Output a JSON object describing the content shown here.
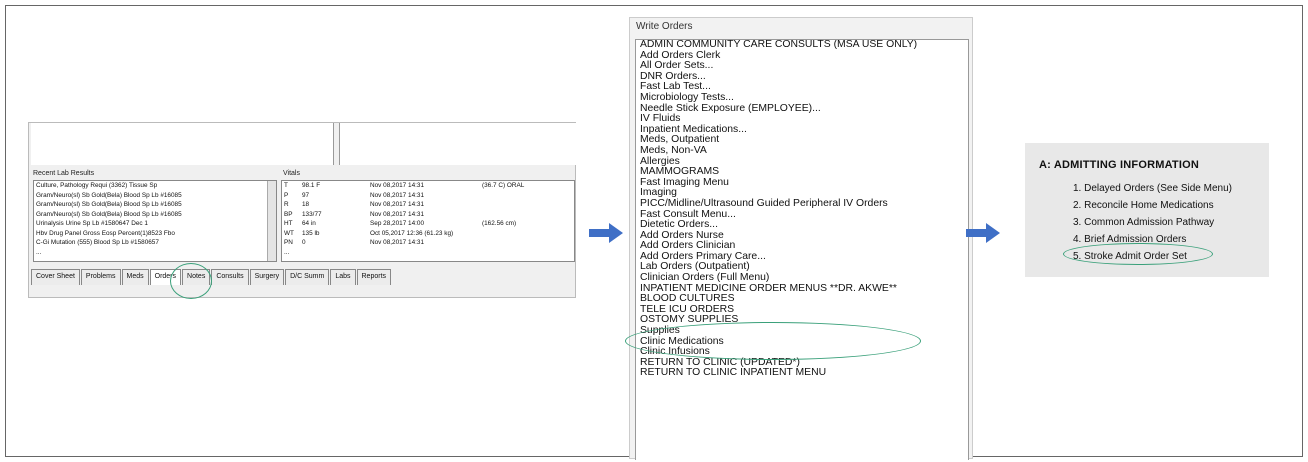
{
  "panel1": {
    "lab_title": "Recent Lab Results",
    "vitals_title": "Vitals",
    "lab_rows": [
      "Culture, Pathology Requi (3362) Tissue Sp",
      "Gram/Neuro(sl) Sb Gold(Bela) Blood Sp Lb #16085",
      "Gram/Neuro(sl) Sb Gold(Bela) Blood Sp Lb #16085",
      "Gram/Neuro(sl) Sb Gold(Bela) Blood Sp Lb #16085",
      "Urinalysis Urine Sp Lb #1580647         Dec 1",
      "Hbv Drug Panel Gross Eosp Percent(1)8523 Fbo",
      "C-Gi Mutation (555) Blood  Sp Lb #1580657",
      "..."
    ],
    "vitals_rows": [
      {
        "k": "T",
        "v": "98.1 F",
        "d": "Nov 08,2017 14:31",
        "x": "(36.7 C)  ORAL"
      },
      {
        "k": "P",
        "v": "97",
        "d": "Nov 08,2017 14:31",
        "x": ""
      },
      {
        "k": "R",
        "v": "18",
        "d": "Nov 08,2017 14:31",
        "x": ""
      },
      {
        "k": "BP",
        "v": "133/77",
        "d": "Nov 08,2017 14:31",
        "x": ""
      },
      {
        "k": "HT",
        "v": "64 in",
        "d": "Sep 28,2017 14:00",
        "x": "(162.56 cm)"
      },
      {
        "k": "WT",
        "v": "135 lb",
        "d": "Oct 05,2017 12:36 (61.23 kg)",
        "x": ""
      },
      {
        "k": "PN",
        "d": "Nov 08,2017 14:31",
        "v": "0",
        "x": ""
      },
      {
        "k": "...",
        "v": "",
        "d": "",
        "x": ""
      }
    ],
    "tabs": [
      "Cover Sheet",
      "Problems",
      "Meds",
      "Orders",
      "Notes",
      "Consults",
      "Surgery",
      "D/C Summ",
      "Labs",
      "Reports"
    ],
    "active_tab": "Orders"
  },
  "panel2": {
    "header": "Write Orders",
    "items": [
      "ADMIN COMMUNITY CARE CONSULTS (MSA USE ONLY)",
      "Add Orders Clerk",
      "All Order Sets...",
      "DNR Orders...",
      "Fast Lab Test...",
      "Microbiology Tests...",
      "Needle Stick Exposure (EMPLOYEE)...",
      "IV Fluids",
      "Inpatient Medications...",
      "Meds, Outpatient",
      "Meds, Non-VA",
      "Allergies",
      "MAMMOGRAMS",
      "Fast Imaging Menu",
      "Imaging",
      "PICC/Midline/Ultrasound Guided Peripheral IV Orders",
      "Fast Consult Menu...",
      "Dietetic Orders...",
      "Add Orders Nurse",
      "Add Orders Clinician",
      "Add Orders Primary Care...",
      "Lab Orders (Outpatient)",
      "Clinician Orders (Full Menu)",
      "INPATIENT MEDICINE ORDER MENUS **DR. AKWE**",
      "BLOOD CULTURES",
      "TELE ICU ORDERS",
      "OSTOMY SUPPLIES",
      "Supplies",
      "Clinic Medications",
      "Clinic Infusions",
      "RETURN TO CLINIC (UPDATED*)",
      "RETURN TO CLINIC INPATIENT MENU"
    ]
  },
  "panel3": {
    "title": "A: ADMITTING INFORMATION",
    "items": [
      "1. Delayed Orders (See Side Menu)",
      "2. Reconcile Home Medications",
      "3. Common Admission Pathway",
      "4. Brief Admission Orders",
      "5. Stroke Admit Order Set"
    ]
  },
  "colors": {
    "arrow": "#3f6fc6",
    "highlight_circle": "#3aa07a"
  }
}
